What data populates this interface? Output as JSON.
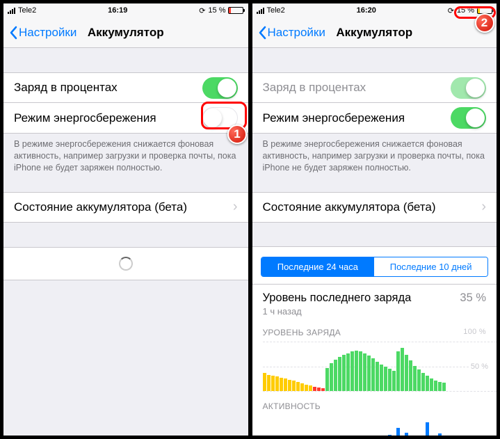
{
  "left": {
    "statusbar": {
      "carrier": "Tele2",
      "time": "16:19",
      "battery_pct": "15 %",
      "battery_fill": 15,
      "battery_color": "#ff3b30"
    },
    "back": "Настройки",
    "title": "Аккумулятор",
    "rows": {
      "percent_label": "Заряд в процентах",
      "lowpower_label": "Режим энергосбережения"
    },
    "footer": "В режиме энергосбережения снижается фоновая активность, например загрузки и проверка почты, пока iPhone не будет заряжен полностью.",
    "health_label": "Состояние аккумулятора (бета)",
    "badge": "1"
  },
  "right": {
    "statusbar": {
      "carrier": "Tele2",
      "time": "16:20",
      "battery_pct": "15 %",
      "battery_fill": 15,
      "battery_color": "#ffcc00"
    },
    "back": "Настройки",
    "title": "Аккумулятор",
    "rows": {
      "percent_label": "Заряд в процентах",
      "lowpower_label": "Режим энергосбережения"
    },
    "footer": "В режиме энергосбережения снижается фоновая активность, например загрузки и проверка почты, пока iPhone не будет заряжен полностью.",
    "health_label": "Состояние аккумулятора (бета)",
    "segmented": {
      "active": "Последние 24 часа",
      "inactive": "Последние 10 дней"
    },
    "last_charge_title": "Уровень последнего заряда",
    "last_charge_pct": "35 %",
    "last_charge_time": "1 ч назад",
    "chart1_label": "УРОВЕНЬ ЗАРЯДА",
    "chart1_max": "100 %",
    "chart1_mid": "50 %",
    "chart2_label": "АКТИВНОСТЬ",
    "badge": "2"
  },
  "chart_data": {
    "type": "bar",
    "title": "УРОВЕНЬ ЗАРЯДА",
    "ylabel": "%",
    "ylim": [
      0,
      100
    ],
    "series": [
      {
        "name": "yellow",
        "values": [
          35,
          32,
          30,
          28,
          26,
          24,
          22,
          20,
          18,
          15,
          12,
          10,
          0,
          0,
          0,
          0,
          0,
          0,
          0,
          0,
          0,
          0,
          0,
          0,
          0,
          0,
          0,
          0,
          0,
          0,
          0,
          0,
          0,
          0,
          0,
          0,
          0,
          0,
          0,
          0,
          0,
          0,
          0,
          0
        ]
      },
      {
        "name": "red",
        "values": [
          0,
          0,
          0,
          0,
          0,
          0,
          0,
          0,
          0,
          0,
          0,
          0,
          8,
          6,
          5,
          0,
          0,
          0,
          0,
          0,
          0,
          0,
          0,
          0,
          0,
          0,
          0,
          0,
          0,
          0,
          0,
          0,
          0,
          0,
          0,
          0,
          0,
          0,
          0,
          0,
          0,
          0,
          0,
          0
        ]
      },
      {
        "name": "green",
        "values": [
          0,
          0,
          0,
          0,
          0,
          0,
          0,
          0,
          0,
          0,
          0,
          0,
          0,
          0,
          0,
          45,
          55,
          62,
          68,
          72,
          75,
          78,
          80,
          78,
          75,
          70,
          65,
          58,
          52,
          48,
          44,
          40,
          78,
          85,
          72,
          60,
          50,
          42,
          36,
          30,
          25,
          20,
          18,
          16
        ]
      }
    ]
  }
}
